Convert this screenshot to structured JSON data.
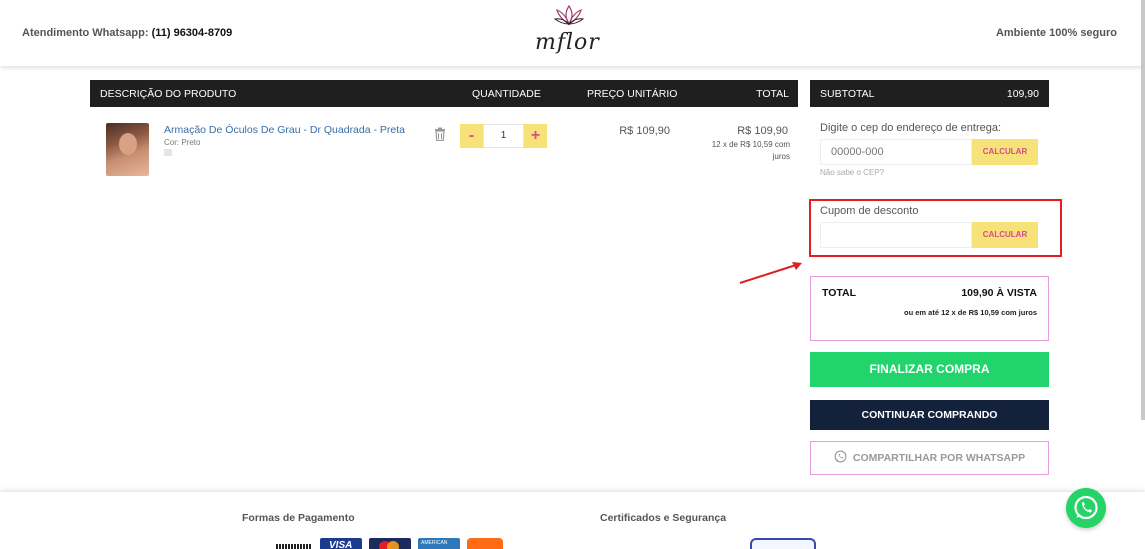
{
  "header": {
    "whatsapp_label": "Atendimento Whatsapp:",
    "whatsapp_number": "(11) 96304-8709",
    "logo_text": "mflor",
    "secure_text": "Ambiente 100% seguro"
  },
  "table": {
    "columns": [
      "DESCRIÇÃO DO PRODUTO",
      "QUANTIDADE",
      "PREÇO UNITÁRIO",
      "TOTAL"
    ],
    "item": {
      "name": "Armação De Óculos De Grau - Dr Quadrada - Preta",
      "variant": "Cor: Preto",
      "quantity": "1",
      "minus_label": "-",
      "plus_label": "+",
      "unit_price": "R$ 109,90",
      "total_price": "R$ 109,90",
      "installments": "12 x de R$ 10,59 com juros"
    }
  },
  "summary": {
    "subtotal_label": "SUBTOTAL",
    "subtotal_value": "109,90",
    "cep_label": "Digite o cep do endereço de entrega:",
    "cep_placeholder": "00000-000",
    "calc_label": "CALCULAR",
    "cep_link": "Não sabe o CEP?",
    "coupon_label": "Cupom de desconto",
    "coupon_value": "",
    "total_label": "TOTAL",
    "total_value": "109,90 À VISTA",
    "total_installments": "ou em até 12 x de R$ 10,59 com juros",
    "finalize_label": "FINALIZAR COMPRA",
    "continue_label": "CONTINUAR COMPRANDO",
    "share_label": "COMPARTILHAR POR WHATSAPP"
  },
  "footer": {
    "payment_title": "Formas de Pagamento",
    "security_title": "Certificados e Segurança",
    "visa_text": "VISA",
    "amex_text": "AMERICAN"
  },
  "colors": {
    "accent_yellow": "#f7e27a",
    "accent_pink": "#d84a8a",
    "finalize_green": "#21d46b",
    "continue_navy": "#13213a",
    "highlight_red": "#e02020"
  }
}
